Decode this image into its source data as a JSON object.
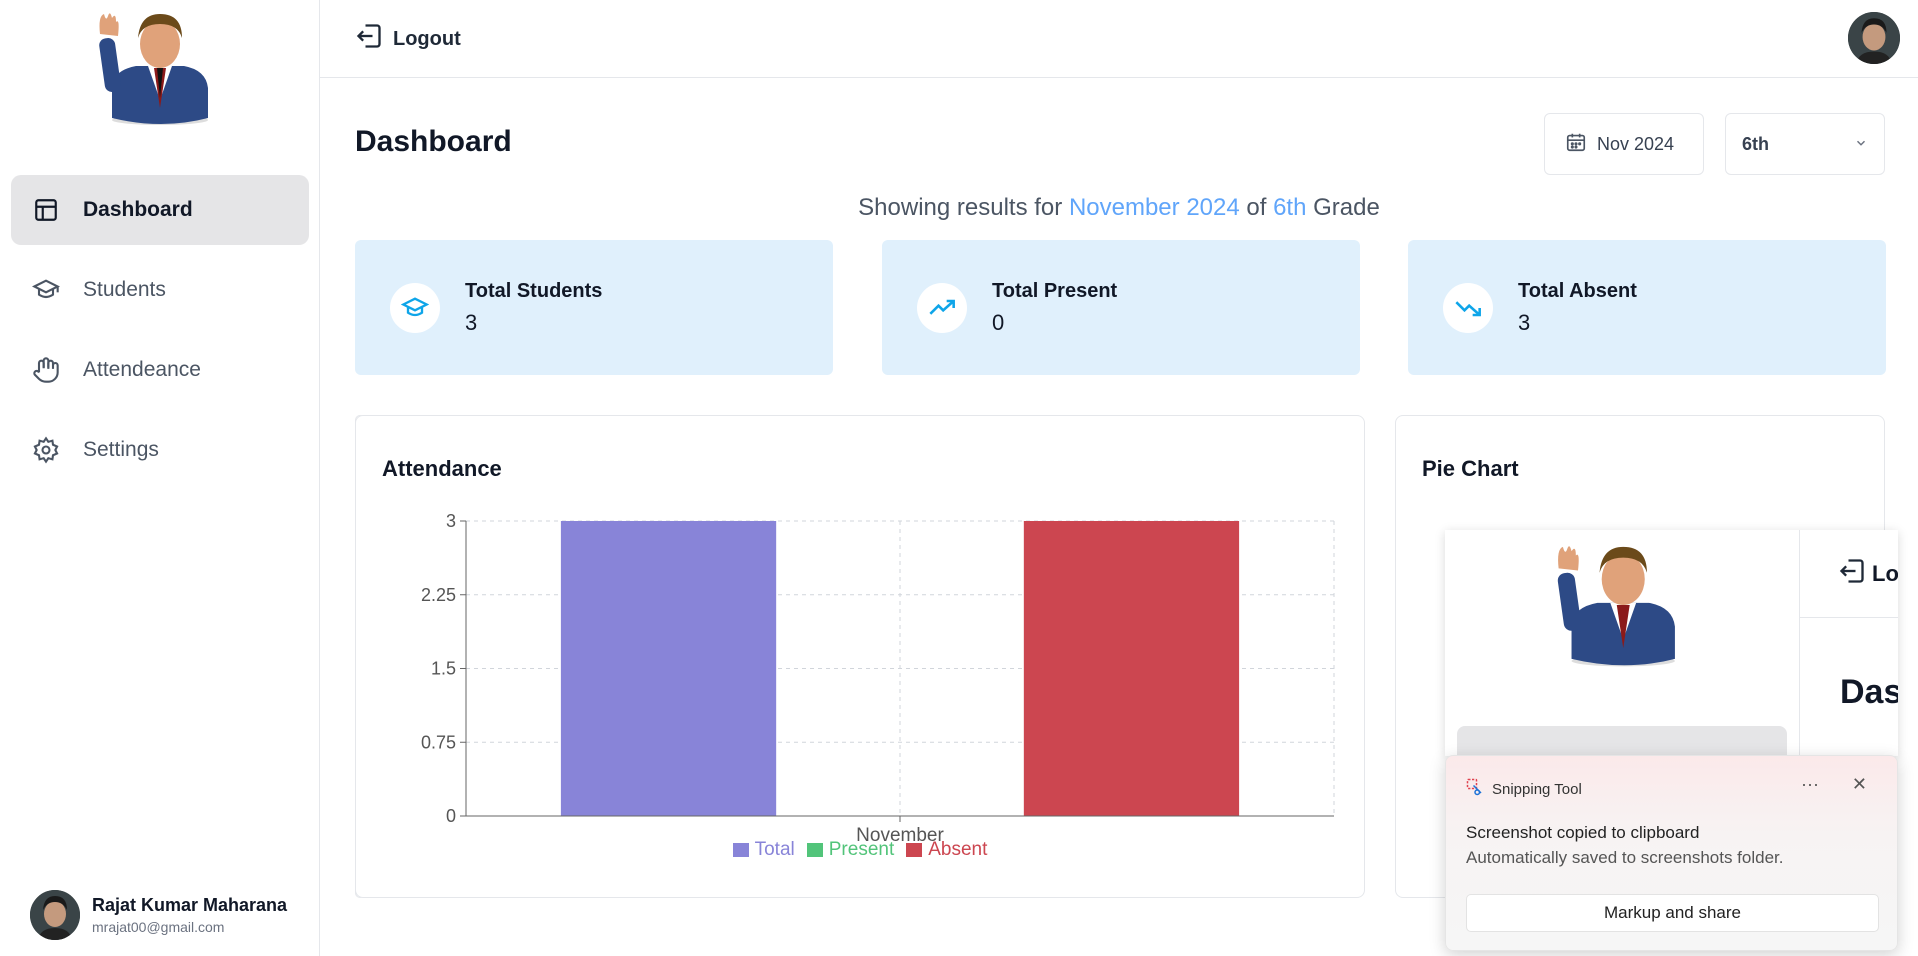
{
  "sidebar": {
    "logo": "student-mascot-logo",
    "items": [
      {
        "label": "Dashboard",
        "icon": "layout-icon",
        "active": true
      },
      {
        "label": "Students",
        "icon": "graduation-cap-icon",
        "active": false
      },
      {
        "label": "Attendeance",
        "icon": "hand-icon",
        "active": false
      },
      {
        "label": "Settings",
        "icon": "gear-icon",
        "active": false
      }
    ],
    "user": {
      "name": "Rajat Kumar Maharana",
      "email": "mrajat00@gmail.com"
    }
  },
  "header": {
    "logout_label": "Logout"
  },
  "main": {
    "title": "Dashboard",
    "month_picker": "Nov 2024",
    "grade_select": "6th",
    "showing": {
      "prefix": "Showing results for",
      "month": "November 2024",
      "mid": "of",
      "grade": "6th",
      "suffix": "Grade"
    },
    "cards": [
      {
        "label": "Total Students",
        "value": "3",
        "icon": "graduation-cap-icon"
      },
      {
        "label": "Total Present",
        "value": "0",
        "icon": "trending-up-icon"
      },
      {
        "label": "Total Absent",
        "value": "3",
        "icon": "trending-down-icon"
      }
    ],
    "attendance_title": "Attendance",
    "pie_title": "Pie Chart"
  },
  "colors": {
    "total": "#8884d8",
    "present": "#52c47a",
    "absent": "#cc4650",
    "card_bg": "#e0f0fc",
    "accent": "#60a5fa"
  },
  "chart_data": {
    "type": "bar",
    "categories": [
      "November"
    ],
    "series": [
      {
        "name": "Total",
        "values": [
          3
        ]
      },
      {
        "name": "Present",
        "values": [
          0
        ]
      },
      {
        "name": "Absent",
        "values": [
          3
        ]
      }
    ],
    "yticks": [
      "0",
      "0.75",
      "1.5",
      "2.25",
      "3"
    ],
    "ylim": [
      0,
      3
    ],
    "grid": true,
    "legend": "bottom"
  },
  "snipping_tool": {
    "app_name": "Snipping Tool",
    "more": "···",
    "close": "✕",
    "title": "Screenshot copied to clipboard",
    "subtitle": "Automatically saved to screenshots folder.",
    "button": "Markup and share",
    "preview_logout": "Lo",
    "preview_title": "Das"
  }
}
